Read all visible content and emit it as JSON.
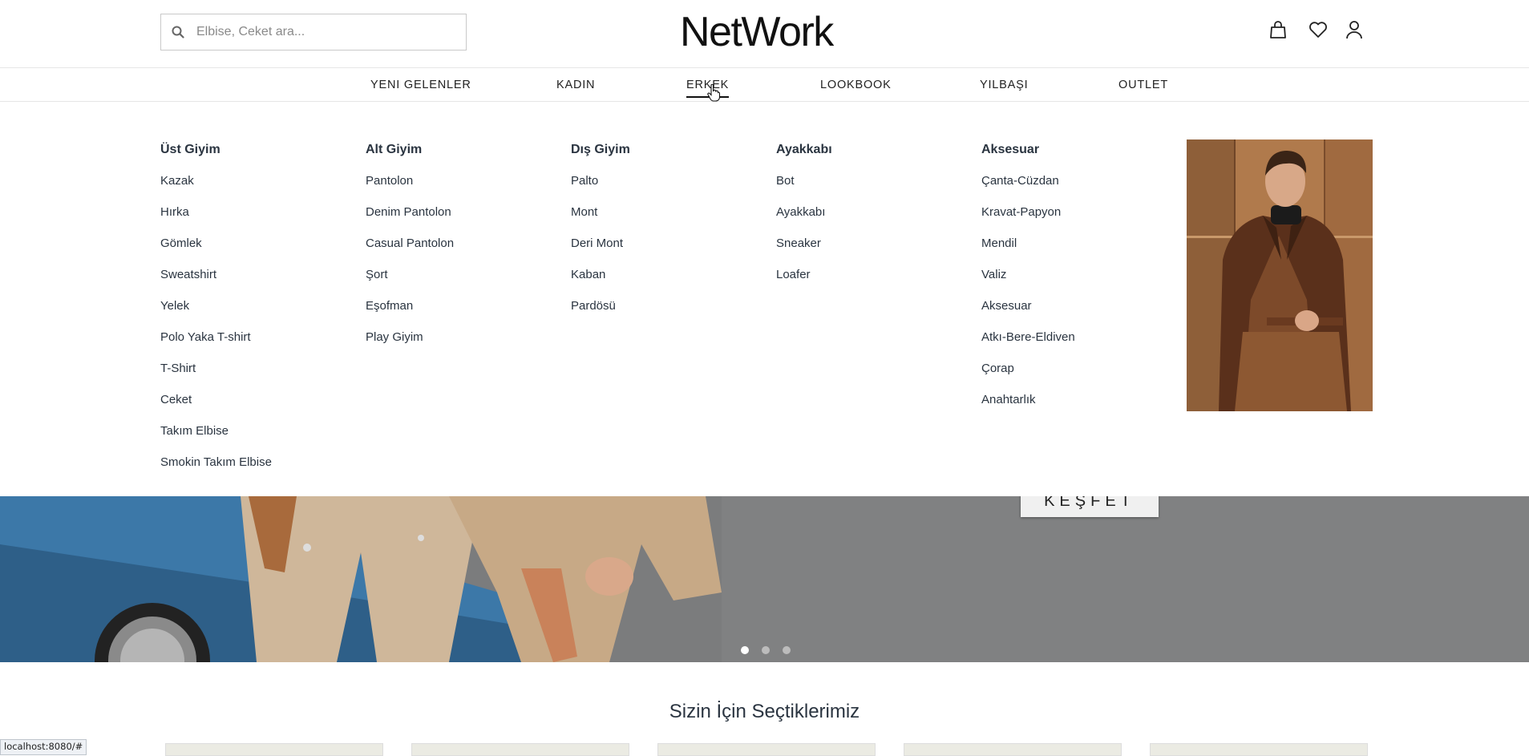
{
  "search": {
    "placeholder": "Elbise, Ceket ara..."
  },
  "logo": {
    "text": "NetWork"
  },
  "nav": {
    "items": [
      {
        "label": "YENI GELENLER"
      },
      {
        "label": "KADIN"
      },
      {
        "label": "ERKEK",
        "active": true
      },
      {
        "label": "LOOKBOOK"
      },
      {
        "label": "YILBAŞI"
      },
      {
        "label": "OUTLET"
      }
    ]
  },
  "menu": {
    "columns": [
      {
        "title": "Üst Giyim",
        "links": [
          "Kazak",
          "Hırka",
          "Gömlek",
          "Sweatshirt",
          "Yelek",
          "Polo Yaka T-shirt",
          "T-Shirt",
          "Ceket",
          "Takım Elbise",
          "Smokin Takım Elbise"
        ]
      },
      {
        "title": "Alt Giyim",
        "links": [
          "Pantolon",
          "Denim Pantolon",
          "Casual Pantolon",
          "Şort",
          "Eşofman",
          "Play Giyim"
        ]
      },
      {
        "title": "Dış Giyim",
        "links": [
          "Palto",
          "Mont",
          "Deri Mont",
          "Kaban",
          "Pardösü"
        ]
      },
      {
        "title": "Ayakkabı",
        "links": [
          "Bot",
          "Ayakkabı",
          "Sneaker",
          "Loafer"
        ]
      },
      {
        "title": "Aksesuar",
        "links": [
          "Çanta-Cüzdan",
          "Kravat-Papyon",
          "Mendil",
          "Valiz",
          "Aksesuar",
          "Atkı-Bere-Eldiven",
          "Çorap",
          "Anahtarlık"
        ]
      }
    ]
  },
  "hero": {
    "cta": "KEŞFET",
    "slides": 3,
    "active_slide": 1
  },
  "section": {
    "title": "Sizin İçin Seçtiklerimiz"
  },
  "status_bar": {
    "url": "localhost:8080/#"
  },
  "colors": {
    "text": "#2a3440",
    "accent": "#111111",
    "hero_bg": "#7a7b7c"
  },
  "icons": {
    "search": "search-icon",
    "bag": "bag-icon",
    "favorites": "heart-icon",
    "account": "user-icon"
  }
}
